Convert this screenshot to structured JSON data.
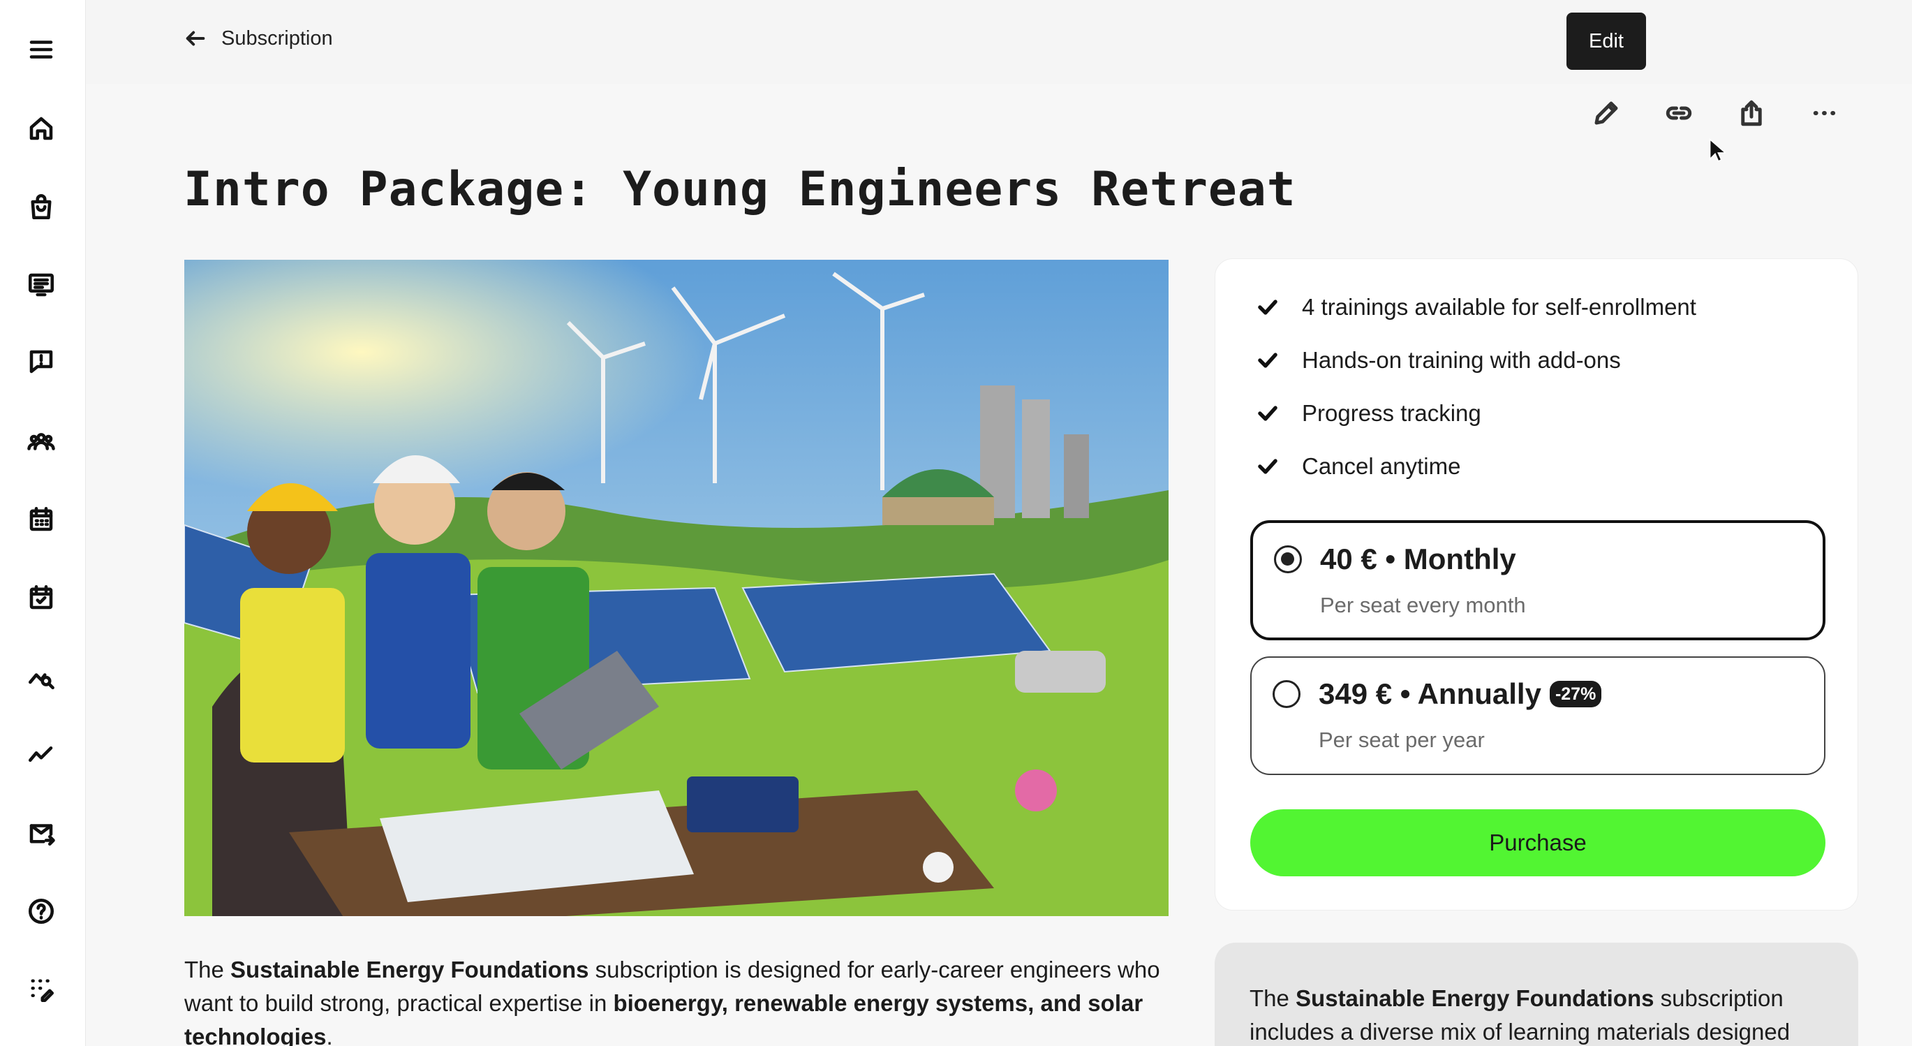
{
  "header": {
    "back_label": "Subscription",
    "tooltip": "Edit",
    "tools": [
      "pencil-icon",
      "link-icon",
      "share-icon",
      "more-icon"
    ]
  },
  "sidebar": {
    "items": [
      "menu-icon",
      "home-icon",
      "shopping-bag-icon",
      "presentation-icon",
      "feedback-icon",
      "users-icon",
      "calendar-icon",
      "calendar-check-icon",
      "analytics-search-icon",
      "trend-line-icon",
      "mail-forward-icon",
      "help-icon",
      "apps-icon"
    ]
  },
  "page": {
    "title": "Intro Package: Young Engineers Retreat"
  },
  "description": {
    "p1": "The ",
    "b1": "Sustainable Energy Foundations",
    "p2": " subscription is designed for early-career engineers who want to build strong, practical expertise in ",
    "b2": "bioenergy, renewable energy systems, and solar technologies",
    "p3": "."
  },
  "features": [
    "4 trainings available for self-enrollment",
    "Hands-on training with add-ons",
    "Progress tracking",
    "Cancel anytime"
  ],
  "plans": [
    {
      "title": "40 € • Monthly",
      "subtitle": "Per seat every month",
      "badge": "",
      "selected": true
    },
    {
      "title": "349 € • Annually",
      "subtitle": "Per seat per year",
      "badge": "-27%",
      "selected": false
    }
  ],
  "purchase_label": "Purchase",
  "info_card": {
    "p1": "The ",
    "b1": "Sustainable Energy Foundations",
    "p2": " subscription includes a diverse mix of learning materials designed"
  },
  "colors": {
    "accent": "#52f532",
    "background": "#f7f7f7"
  }
}
